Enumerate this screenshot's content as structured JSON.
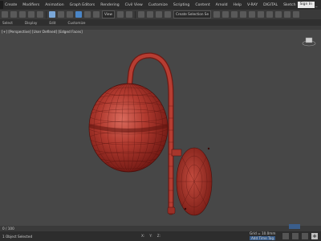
{
  "menubar": {
    "items": [
      "Create",
      "Modifiers",
      "Animation",
      "Graph Editors",
      "Rendering",
      "Civil View",
      "Customize",
      "Scripting",
      "Content",
      "Arnold",
      "Help",
      "V-RAY",
      "DIGITAL",
      "Sketch"
    ],
    "sign_in": "Sign In",
    "win_control": "_"
  },
  "toolbar": {
    "view_dropdown": "View",
    "selection_set": "Create Selection Se"
  },
  "tabs": [
    "Select",
    "Display",
    "Edit",
    "Customize"
  ],
  "viewport": {
    "label": "[+] [Perspective] [User Defined] [Edged Faces]"
  },
  "status": {
    "left_text": "1 Object Selected",
    "coords": [
      "X:",
      "Y:",
      "Z:"
    ],
    "grid": "Grid = 10.0mm",
    "tag": "Add Time Tag",
    "frame": "0 / 100"
  },
  "colors": {
    "sphere_red": "#b2352d",
    "bg_gray": "#474747"
  }
}
